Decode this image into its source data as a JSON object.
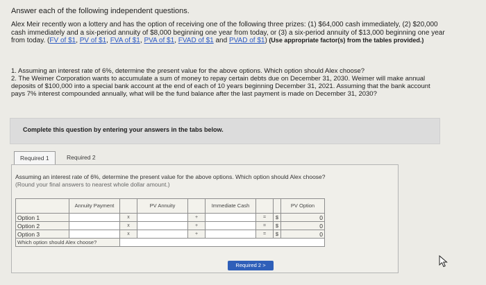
{
  "heading": "Answer each of the following independent questions.",
  "intro": {
    "text1": "Alex Meir recently won a lottery and has the option of receiving one of the following three prizes: (1) $64,000 cash immediately, (2) $20,000 cash immediately and a six-period annuity of $8,000 beginning one year from today, or (3) a six-period annuity of $13,000 beginning one year from today. (",
    "links": [
      "FV of $1",
      "PV of $1",
      "FVA of $1",
      "PVA of $1",
      "FVAD of $1",
      "PVAD of $1"
    ],
    "sep": ", ",
    "and": " and ",
    "close": ")",
    "note": " (Use appropriate factor(s) from the tables provided.)"
  },
  "questions": {
    "q1": "1. Assuming an interest rate of 6%, determine the present value for the above options. Which option should Alex choose?",
    "q2": "2. The Weimer Corporation wants to accumulate a sum of money to repay certain debts due on December 31, 2030. Weimer will make annual deposits of $100,000 into a special bank account at the end of each of 10 years beginning December 31, 2021. Assuming that the bank account pays 7% interest compounded annually, what will be the fund balance after the last payment is made on December 31, 2030?"
  },
  "panel": {
    "text": "Complete this question by entering your answers in the tabs below."
  },
  "tabs": [
    {
      "label": "Required 1",
      "active": true
    },
    {
      "label": "Required 2",
      "active": false
    }
  ],
  "instructions": {
    "line1": "Assuming an interest rate of 6%, determine the present value for the above options. Which option should Alex choose?",
    "line2": "(Round your final answers to nearest whole dollar amount.)"
  },
  "table": {
    "headers": [
      "Annuity Payment",
      "PV Annuity",
      "Immediate Cash",
      "PV Option"
    ],
    "rows": [
      {
        "label": "Option 1",
        "op1": "x",
        "op2": "+",
        "eq": "=",
        "dollar": "$",
        "value": "0"
      },
      {
        "label": "Option 2",
        "op1": "x",
        "op2": "+",
        "eq": "=",
        "dollar": "$",
        "value": "0"
      },
      {
        "label": "Option 3",
        "op1": "x",
        "op2": "+",
        "eq": "=",
        "dollar": "$",
        "value": "0"
      }
    ],
    "choice_label": "Which option should Alex choose?"
  },
  "next_button": {
    "label": "Required 2",
    "arrow": ">"
  },
  "colors": {
    "accent": "#2f5fb9",
    "link": "#2b59c3"
  },
  "icons": {
    "cursor": "pointer-cursor-icon"
  }
}
